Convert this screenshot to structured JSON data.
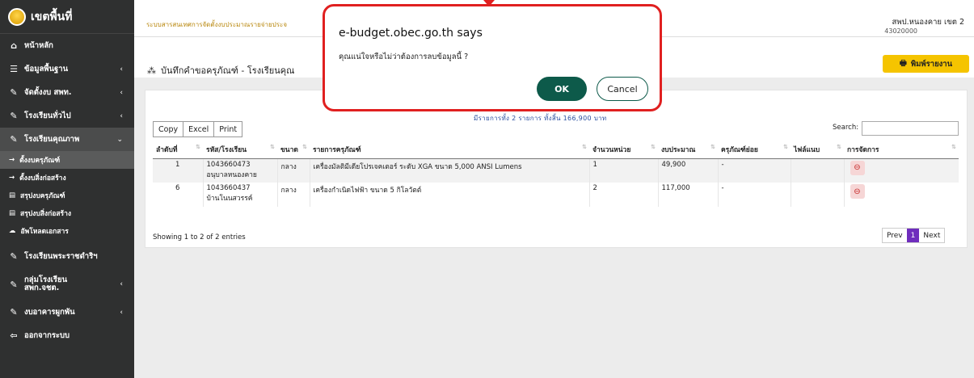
{
  "sidebar": {
    "title": "เขตพื้นที่",
    "items": [
      {
        "label": "หน้าหลัก"
      },
      {
        "label": "ข้อมูลพื้นฐาน",
        "chevron": "‹"
      },
      {
        "label": "จัดตั้งงบ สพท.",
        "chevron": "‹"
      },
      {
        "label": "โรงเรียนทั่วไป",
        "chevron": "‹"
      },
      {
        "label": "โรงเรียนคุณภาพ",
        "chevron": "⌄"
      },
      {
        "label": "โรงเรียนพระราชดำริฯ"
      },
      {
        "label": "กลุ่มโรงเรียน สพก.จชต.",
        "chevron": "‹"
      },
      {
        "label": "งบอาคารผูกพัน",
        "chevron": "‹"
      },
      {
        "label": "ออกจากระบบ"
      }
    ],
    "subitems": [
      {
        "label": "ตั้งงบครุภัณฑ์"
      },
      {
        "label": "ตั้งงบสิ่งก่อสร้าง"
      },
      {
        "label": "สรุปงบครุภัณฑ์"
      },
      {
        "label": "สรุปงบสิ่งก่อสร้าง"
      },
      {
        "label": "อัพโหลดเอกสาร"
      }
    ]
  },
  "header": {
    "system_name": "ระบบสารสนเทศการจัดตั้งงบประมาณรายจ่ายประจ",
    "area_name": "สพป.หนองคาย เขต 2",
    "area_code": "43020000"
  },
  "page": {
    "heading": "บันทึกคำขอครุภัณฑ์ - โรงเรียนคุณ",
    "print_label": "พิมพ์รายงาน",
    "partial_text": "มีรายการทั้ง 2 รายการ ทั้งสิ้น 166,900 บาท"
  },
  "toolbar": {
    "copy": "Copy",
    "excel": "Excel",
    "print": "Print",
    "search_label": "Search:"
  },
  "table": {
    "headers": [
      "ลำดับที่",
      "รหัส/โรงเรียน",
      "ขนาด",
      "รายการครุภัณฑ์",
      "จำนวนหน่วย",
      "งบประมาณ",
      "ครุภัณฑ์ย่อย",
      "ไฟล์แนบ",
      "การจัดการ"
    ],
    "rows": [
      {
        "no": "1",
        "code": "1043660473",
        "school": "อนุบาลหนองคาย",
        "size": "กลาง",
        "item": "เครื่องมัลติมีเดียโปรเจคเตอร์ ระดับ XGA ขนาด 5,000 ANSI Lumens",
        "qty": "1",
        "budget": "49,900",
        "sub": "-",
        "file": ""
      },
      {
        "no": "6",
        "code": "1043660437",
        "school": "บ้านโนนสวรรค์",
        "size": "กลาง",
        "item": "เครื่องกำเนิดไฟฟ้า ขนาด 5 กิโลวัตต์",
        "qty": "2",
        "budget": "117,000",
        "sub": "-",
        "file": ""
      }
    ],
    "info": "Showing 1 to 2 of 2 entries"
  },
  "pager": {
    "prev": "Prev",
    "current": "1",
    "next": "Next"
  },
  "dialog": {
    "title": "e-budget.obec.go.th says",
    "message": "คุณแน่ใจหรือไม่ว่าต้องการลบข้อมูลนี้ ?",
    "ok": "OK",
    "cancel": "Cancel"
  },
  "colors": {
    "sidebar": "#2f3030",
    "accent_yellow": "#f5c400",
    "dialog_border": "#e02020",
    "ok_button": "#0d5a4a",
    "pager_active": "#6f2dbd"
  }
}
